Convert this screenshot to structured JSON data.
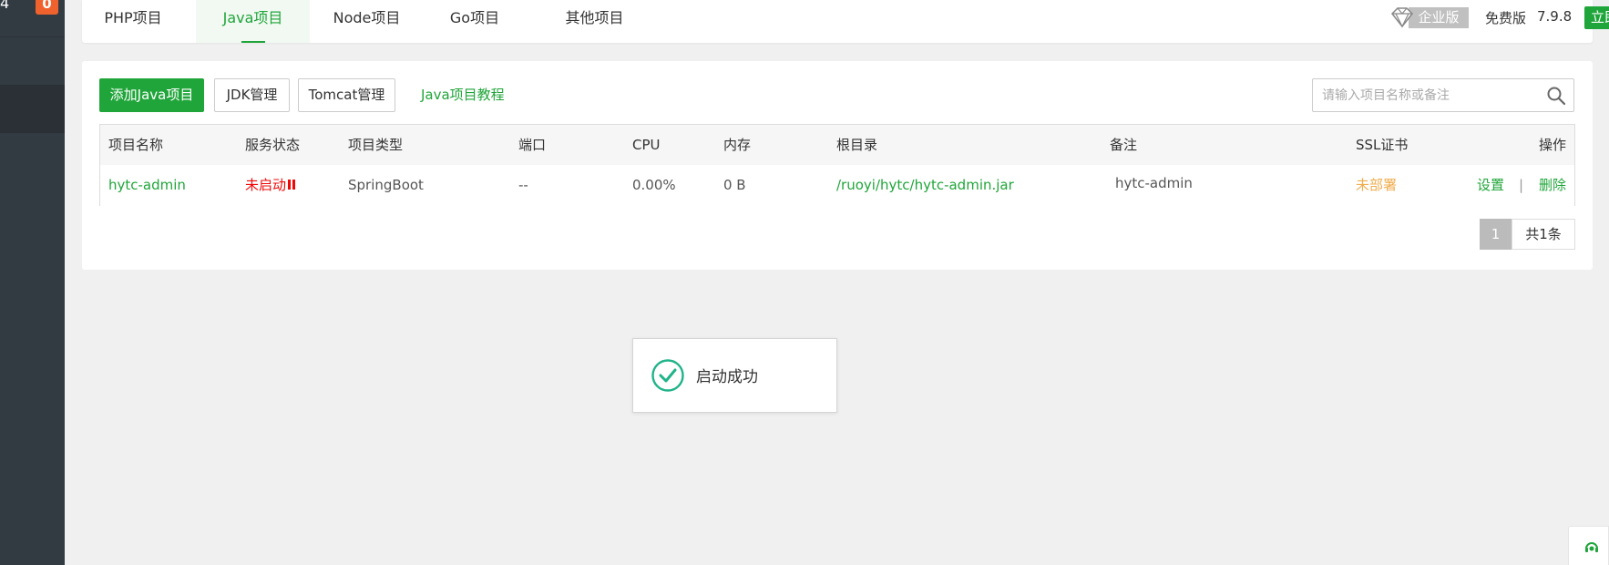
{
  "sidebar": {
    "count_text": "4",
    "badge": "0"
  },
  "tabs": [
    {
      "label": "PHP项目",
      "active": false
    },
    {
      "label": "Java项目",
      "active": true
    },
    {
      "label": "Node项目",
      "active": false
    },
    {
      "label": "Go项目",
      "active": false
    },
    {
      "label": "其他项目",
      "active": false
    }
  ],
  "header": {
    "enterprise_label": "企业版",
    "free_label": "免费版",
    "version": "7.9.8",
    "upgrade_label": "立即升级"
  },
  "toolbar": {
    "add_label": "添加Java项目",
    "jdk_label": "JDK管理",
    "tomcat_label": "Tomcat管理",
    "tutorial_label": "Java项目教程"
  },
  "search": {
    "placeholder": "请输入项目名称或备注",
    "value": ""
  },
  "table": {
    "columns": [
      "项目名称",
      "服务状态",
      "项目类型",
      "端口",
      "CPU",
      "内存",
      "根目录",
      "备注",
      "SSL证书",
      "操作"
    ],
    "rows": [
      {
        "name": "hytc-admin",
        "status": "未启动",
        "type": "SpringBoot",
        "port": "--",
        "cpu": "0.00%",
        "memory": "0 B",
        "root": "/ruoyi/hytc/hytc-admin.jar",
        "note": "hytc-admin",
        "ssl": "未部署",
        "action_settings": "设置",
        "action_sep": "|",
        "action_delete": "删除"
      }
    ]
  },
  "pagination": {
    "current": "1",
    "total": "共1条"
  },
  "toast": {
    "message": "启动成功"
  },
  "colors": {
    "accent": "#20a53a",
    "danger": "#ef0808",
    "warning": "#f0ad4e",
    "sidebar": "#333b42"
  },
  "icons": {
    "enterprise": "diamond-icon",
    "search": "search-icon",
    "toast": "check-circle-icon",
    "status": "pause-icon",
    "float": "customer-service-icon"
  }
}
